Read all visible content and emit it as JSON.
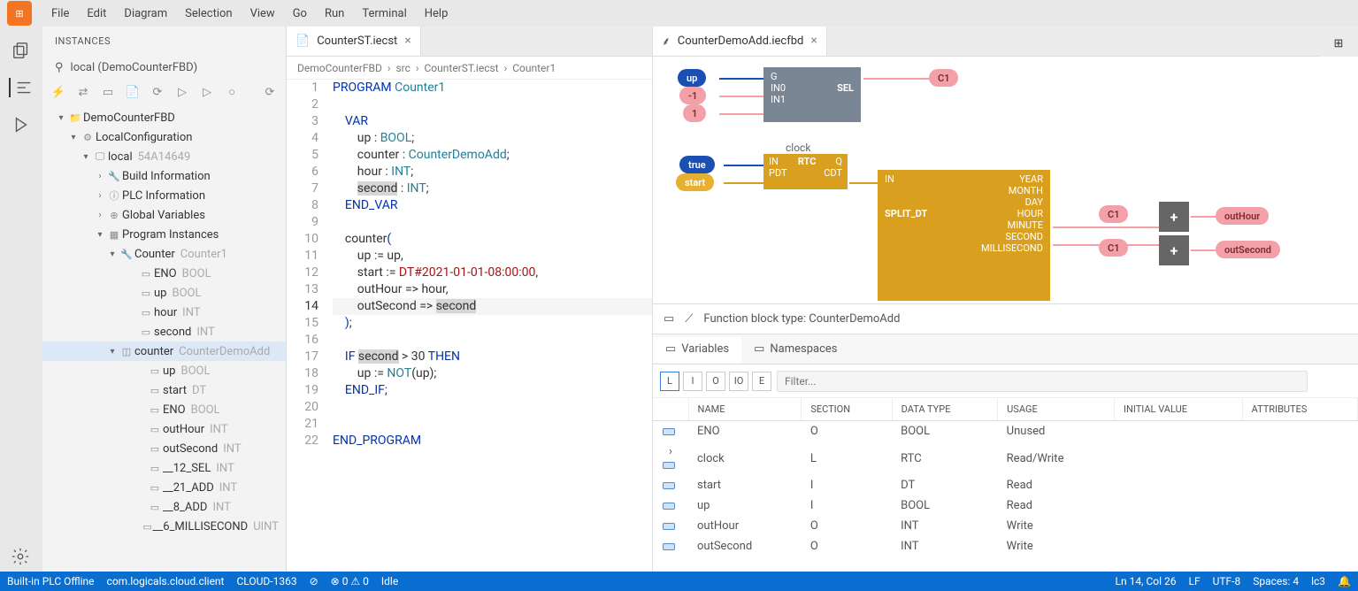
{
  "menu": {
    "items": [
      "File",
      "Edit",
      "Diagram",
      "Selection",
      "View",
      "Go",
      "Run",
      "Terminal",
      "Help"
    ]
  },
  "sidebar": {
    "title": "INSTANCES",
    "sub": "local (DemoCounterFBD)",
    "tree": [
      {
        "pad": 14,
        "chev": "▾",
        "ico": "📁",
        "label": "DemoCounterFBD"
      },
      {
        "pad": 28,
        "chev": "▾",
        "ico": "⚙",
        "label": "LocalConfiguration"
      },
      {
        "pad": 42,
        "chev": "▾",
        "ico": "🖵",
        "label": "local",
        "dim": "54A14649"
      },
      {
        "pad": 58,
        "chev": "›",
        "ico": "🔧",
        "label": "Build Information"
      },
      {
        "pad": 58,
        "chev": "›",
        "ico": "ⓘ",
        "label": "PLC Information"
      },
      {
        "pad": 58,
        "chev": "›",
        "ico": "⊕",
        "label": "Global Variables"
      },
      {
        "pad": 58,
        "chev": "▾",
        "ico": "▦",
        "label": "Program Instances"
      },
      {
        "pad": 72,
        "chev": "▾",
        "ico": "🔧",
        "label": "Counter",
        "dim": "Counter1"
      },
      {
        "pad": 94,
        "chev": "",
        "ico": "▭",
        "label": "ENO",
        "dim": "BOOL"
      },
      {
        "pad": 94,
        "chev": "",
        "ico": "▭",
        "label": "up",
        "dim": "BOOL"
      },
      {
        "pad": 94,
        "chev": "",
        "ico": "▭",
        "label": "hour",
        "dim": "INT"
      },
      {
        "pad": 94,
        "chev": "",
        "ico": "▭",
        "label": "second",
        "dim": "INT"
      },
      {
        "pad": 72,
        "chev": "▾",
        "ico": "◫",
        "label": "counter",
        "dim": "CounterDemoAdd",
        "sel": true
      },
      {
        "pad": 104,
        "chev": "",
        "ico": "▭",
        "label": "up",
        "dim": "BOOL"
      },
      {
        "pad": 104,
        "chev": "",
        "ico": "▭",
        "label": "start",
        "dim": "DT"
      },
      {
        "pad": 104,
        "chev": "",
        "ico": "▭",
        "label": "ENO",
        "dim": "BOOL"
      },
      {
        "pad": 104,
        "chev": "",
        "ico": "▭",
        "label": "outHour",
        "dim": "INT"
      },
      {
        "pad": 104,
        "chev": "",
        "ico": "▭",
        "label": "outSecond",
        "dim": "INT"
      },
      {
        "pad": 104,
        "chev": "",
        "ico": "▭",
        "label": "__12_SEL",
        "dim": "INT"
      },
      {
        "pad": 104,
        "chev": "",
        "ico": "▭",
        "label": "__21_ADD",
        "dim": "INT"
      },
      {
        "pad": 104,
        "chev": "",
        "ico": "▭",
        "label": "__8_ADD",
        "dim": "INT"
      },
      {
        "pad": 104,
        "chev": "",
        "ico": "▭",
        "label": "__6_MILLISECOND",
        "dim": "UINT"
      }
    ]
  },
  "tabs": {
    "left": {
      "icon": "📄",
      "label": "CounterST.iecst"
    },
    "right": {
      "icon": "⸙",
      "label": "CounterDemoAdd.iecfbd"
    }
  },
  "breadcrumb": [
    "DemoCounterFBD",
    "src",
    "CounterST.iecst",
    "Counter1"
  ],
  "code": {
    "lines": [
      {
        "n": 1,
        "h": "<span class='kw'>PROGRAM</span> <span class='ty'>Counter1</span>"
      },
      {
        "n": 2,
        "h": ""
      },
      {
        "n": 3,
        "h": "    <span class='kw'>VAR</span>"
      },
      {
        "n": 4,
        "h": "        up : <span class='ty'>BOOL</span>;"
      },
      {
        "n": 5,
        "h": "        counter : <span class='ty'>CounterDemoAdd</span>;"
      },
      {
        "n": 6,
        "h": "        hour : <span class='ty'>INT</span>;"
      },
      {
        "n": 7,
        "h": "        <span class='hl'>second</span> : <span class='ty'>INT</span>;"
      },
      {
        "n": 8,
        "h": "    <span class='kw'>END_VAR</span>"
      },
      {
        "n": 9,
        "h": ""
      },
      {
        "n": 10,
        "h": "    counter<span class='kw'>(</span>"
      },
      {
        "n": 11,
        "h": "        up := up,"
      },
      {
        "n": 12,
        "h": "        start := <span class='str'>DT#2021-01-01-08:00:00</span>,"
      },
      {
        "n": 13,
        "h": "        outHour =&gt; hour,"
      },
      {
        "n": 14,
        "h": "        outSecond =&gt; <span class='hl'>second</span>",
        "cur": true
      },
      {
        "n": 15,
        "h": "    <span class='kw'>)</span>;"
      },
      {
        "n": 16,
        "h": ""
      },
      {
        "n": 17,
        "h": "    <span class='kw'>IF</span> <span class='hl'>second</span> &gt; 30 <span class='kw'>THEN</span>"
      },
      {
        "n": 18,
        "h": "        up := <span class='ty'>NOT</span>(up);"
      },
      {
        "n": 19,
        "h": "    <span class='kw'>END_IF</span>;"
      },
      {
        "n": 20,
        "h": ""
      },
      {
        "n": 21,
        "h": ""
      },
      {
        "n": 22,
        "h": "<span class='kw'>END_PROGRAM</span>"
      }
    ]
  },
  "fbd": {
    "typeLabel": "Function block type: CounterDemoAdd",
    "varTabs": {
      "vars": "Variables",
      "ns": "Namespaces"
    },
    "filterButtons": [
      "L",
      "I",
      "O",
      "IO",
      "E"
    ],
    "filterPlaceholder": "Filter...",
    "headers": [
      "NAME",
      "SECTION",
      "DATA TYPE",
      "USAGE",
      "INITIAL VALUE",
      "ATTRIBUTES"
    ],
    "rows": [
      {
        "name": "ENO",
        "section": "O",
        "type": "BOOL",
        "usage": "Unused"
      },
      {
        "name": "clock",
        "section": "L",
        "type": "RTC",
        "usage": "Read/Write",
        "exp": true
      },
      {
        "name": "start",
        "section": "I",
        "type": "DT",
        "usage": "Read"
      },
      {
        "name": "up",
        "section": "I",
        "type": "BOOL",
        "usage": "Read"
      },
      {
        "name": "outHour",
        "section": "O",
        "type": "INT",
        "usage": "Write"
      },
      {
        "name": "outSecond",
        "section": "O",
        "type": "INT",
        "usage": "Write"
      }
    ],
    "blocks": {
      "sel": {
        "label": "SEL",
        "in": [
          "G",
          "IN0",
          "IN1"
        ]
      },
      "rtc": {
        "label": "clock",
        "type": "RTC",
        "in": [
          "IN",
          "PDT"
        ],
        "out": [
          "Q",
          "CDT"
        ]
      },
      "split": {
        "label": "SPLIT_DT",
        "in": [
          "IN"
        ],
        "out": [
          "YEAR",
          "MONTH",
          "DAY",
          "HOUR",
          "MINUTE",
          "SECOND",
          "MILLISECOND"
        ]
      },
      "pins": {
        "up": "up",
        "m1": "-1",
        "p1": "1",
        "c1a": "C1",
        "true": "true",
        "start": "start",
        "c1b": "C1",
        "c1c": "C1",
        "outHour": "outHour",
        "outSecond": "outSecond",
        "add": "+"
      }
    }
  },
  "status": {
    "left": [
      "Built-in PLC Offline",
      "com.logicals.cloud.client",
      "CLOUD-1363",
      "⊘",
      "⊗ 0 ⚠ 0",
      "Idle"
    ],
    "right": [
      "Ln 14, Col 26",
      "LF",
      "UTF-8",
      "Spaces: 4",
      "lc3",
      "🔔"
    ]
  }
}
